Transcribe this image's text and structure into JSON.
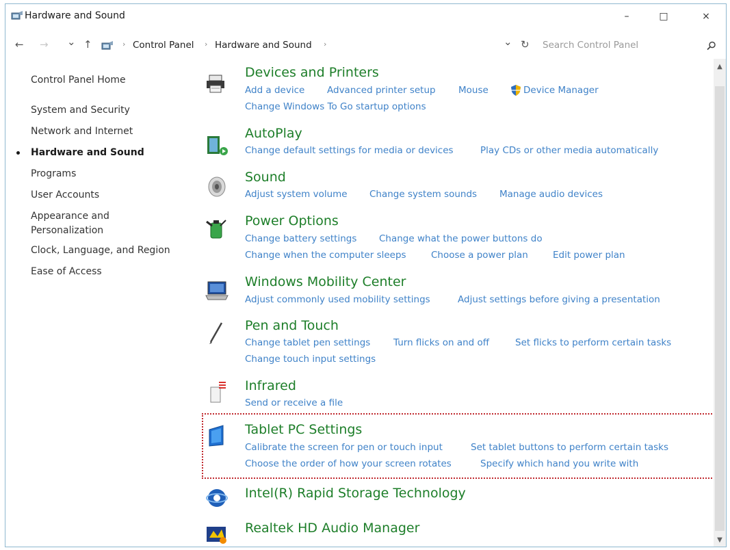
{
  "window": {
    "title": "Hardware and Sound",
    "minimize_glyph": "–",
    "maximize_glyph": "□",
    "close_glyph": "×"
  },
  "nav": {
    "back_glyph": "←",
    "forward_glyph": "→",
    "recent_glyph": "⌄",
    "up_glyph": "↑",
    "breadcrumbs": [
      "Control Panel",
      "Hardware and Sound"
    ],
    "separator": "›",
    "dropdown_glyph": "⌄",
    "refresh_glyph": "↻",
    "search_placeholder": "Search Control Panel"
  },
  "sidebar": {
    "items": [
      {
        "label": "Control Panel Home"
      },
      {
        "label": "System and Security"
      },
      {
        "label": "Network and Internet"
      },
      {
        "label": "Hardware and Sound"
      },
      {
        "label": "Programs"
      },
      {
        "label": "User Accounts"
      },
      {
        "label": "Appearance and"
      },
      {
        "label": "Personalization"
      },
      {
        "label": "Clock, Language, and Region"
      },
      {
        "label": "Ease of Access"
      }
    ]
  },
  "categories": [
    {
      "title": "Devices and Printers",
      "links": [
        "Add a device",
        "Advanced printer setup",
        "Mouse",
        "Device Manager",
        "Change Windows To Go startup options"
      ]
    },
    {
      "title": "AutoPlay",
      "links": [
        "Change default settings for media or devices",
        "Play CDs or other media automatically"
      ]
    },
    {
      "title": "Sound",
      "links": [
        "Adjust system volume",
        "Change system sounds",
        "Manage audio devices"
      ]
    },
    {
      "title": "Power Options",
      "links": [
        "Change battery settings",
        "Change what the power buttons do",
        "Change when the computer sleeps",
        "Choose a power plan",
        "Edit power plan"
      ]
    },
    {
      "title": "Windows Mobility Center",
      "links": [
        "Adjust commonly used mobility settings",
        "Adjust settings before giving a presentation"
      ]
    },
    {
      "title": "Pen and Touch",
      "links": [
        "Change tablet pen settings",
        "Turn flicks on and off",
        "Set flicks to perform certain tasks",
        "Change touch input settings"
      ]
    },
    {
      "title": "Infrared",
      "links": [
        "Send or receive a file"
      ]
    },
    {
      "title": "Tablet PC Settings",
      "links": [
        "Calibrate the screen for pen or touch input",
        "Set tablet buttons to perform certain tasks",
        "Choose the order of how your screen rotates",
        "Specify which hand you write with"
      ]
    },
    {
      "title": "Intel(R) Rapid Storage Technology",
      "links": []
    },
    {
      "title": "Realtek HD Audio Manager",
      "links": []
    }
  ],
  "colors": {
    "category_title": "#1d7e29",
    "link": "#3f82c8",
    "highlight_border": "#c0282d"
  }
}
